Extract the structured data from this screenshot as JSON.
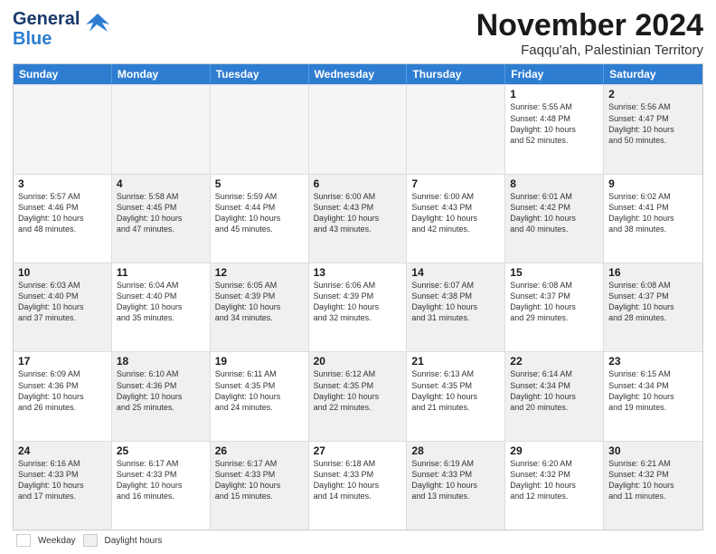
{
  "header": {
    "logo_line1": "General",
    "logo_line2": "Blue",
    "title": "November 2024",
    "subtitle": "Faqqu'ah, Palestinian Territory"
  },
  "calendar": {
    "days_of_week": [
      "Sunday",
      "Monday",
      "Tuesday",
      "Wednesday",
      "Thursday",
      "Friday",
      "Saturday"
    ],
    "weeks": [
      [
        {
          "day": "",
          "info": "",
          "empty": true
        },
        {
          "day": "",
          "info": "",
          "empty": true
        },
        {
          "day": "",
          "info": "",
          "empty": true
        },
        {
          "day": "",
          "info": "",
          "empty": true
        },
        {
          "day": "",
          "info": "",
          "empty": true
        },
        {
          "day": "1",
          "info": "Sunrise: 5:55 AM\nSunset: 4:48 PM\nDaylight: 10 hours\nand 52 minutes.",
          "shaded": false
        },
        {
          "day": "2",
          "info": "Sunrise: 5:56 AM\nSunset: 4:47 PM\nDaylight: 10 hours\nand 50 minutes.",
          "shaded": true
        }
      ],
      [
        {
          "day": "3",
          "info": "Sunrise: 5:57 AM\nSunset: 4:46 PM\nDaylight: 10 hours\nand 48 minutes.",
          "shaded": false
        },
        {
          "day": "4",
          "info": "Sunrise: 5:58 AM\nSunset: 4:45 PM\nDaylight: 10 hours\nand 47 minutes.",
          "shaded": true
        },
        {
          "day": "5",
          "info": "Sunrise: 5:59 AM\nSunset: 4:44 PM\nDaylight: 10 hours\nand 45 minutes.",
          "shaded": false
        },
        {
          "day": "6",
          "info": "Sunrise: 6:00 AM\nSunset: 4:43 PM\nDaylight: 10 hours\nand 43 minutes.",
          "shaded": true
        },
        {
          "day": "7",
          "info": "Sunrise: 6:00 AM\nSunset: 4:43 PM\nDaylight: 10 hours\nand 42 minutes.",
          "shaded": false
        },
        {
          "day": "8",
          "info": "Sunrise: 6:01 AM\nSunset: 4:42 PM\nDaylight: 10 hours\nand 40 minutes.",
          "shaded": true
        },
        {
          "day": "9",
          "info": "Sunrise: 6:02 AM\nSunset: 4:41 PM\nDaylight: 10 hours\nand 38 minutes.",
          "shaded": false
        }
      ],
      [
        {
          "day": "10",
          "info": "Sunrise: 6:03 AM\nSunset: 4:40 PM\nDaylight: 10 hours\nand 37 minutes.",
          "shaded": true
        },
        {
          "day": "11",
          "info": "Sunrise: 6:04 AM\nSunset: 4:40 PM\nDaylight: 10 hours\nand 35 minutes.",
          "shaded": false
        },
        {
          "day": "12",
          "info": "Sunrise: 6:05 AM\nSunset: 4:39 PM\nDaylight: 10 hours\nand 34 minutes.",
          "shaded": true
        },
        {
          "day": "13",
          "info": "Sunrise: 6:06 AM\nSunset: 4:39 PM\nDaylight: 10 hours\nand 32 minutes.",
          "shaded": false
        },
        {
          "day": "14",
          "info": "Sunrise: 6:07 AM\nSunset: 4:38 PM\nDaylight: 10 hours\nand 31 minutes.",
          "shaded": true
        },
        {
          "day": "15",
          "info": "Sunrise: 6:08 AM\nSunset: 4:37 PM\nDaylight: 10 hours\nand 29 minutes.",
          "shaded": false
        },
        {
          "day": "16",
          "info": "Sunrise: 6:08 AM\nSunset: 4:37 PM\nDaylight: 10 hours\nand 28 minutes.",
          "shaded": true
        }
      ],
      [
        {
          "day": "17",
          "info": "Sunrise: 6:09 AM\nSunset: 4:36 PM\nDaylight: 10 hours\nand 26 minutes.",
          "shaded": false
        },
        {
          "day": "18",
          "info": "Sunrise: 6:10 AM\nSunset: 4:36 PM\nDaylight: 10 hours\nand 25 minutes.",
          "shaded": true
        },
        {
          "day": "19",
          "info": "Sunrise: 6:11 AM\nSunset: 4:35 PM\nDaylight: 10 hours\nand 24 minutes.",
          "shaded": false
        },
        {
          "day": "20",
          "info": "Sunrise: 6:12 AM\nSunset: 4:35 PM\nDaylight: 10 hours\nand 22 minutes.",
          "shaded": true
        },
        {
          "day": "21",
          "info": "Sunrise: 6:13 AM\nSunset: 4:35 PM\nDaylight: 10 hours\nand 21 minutes.",
          "shaded": false
        },
        {
          "day": "22",
          "info": "Sunrise: 6:14 AM\nSunset: 4:34 PM\nDaylight: 10 hours\nand 20 minutes.",
          "shaded": true
        },
        {
          "day": "23",
          "info": "Sunrise: 6:15 AM\nSunset: 4:34 PM\nDaylight: 10 hours\nand 19 minutes.",
          "shaded": false
        }
      ],
      [
        {
          "day": "24",
          "info": "Sunrise: 6:16 AM\nSunset: 4:33 PM\nDaylight: 10 hours\nand 17 minutes.",
          "shaded": true
        },
        {
          "day": "25",
          "info": "Sunrise: 6:17 AM\nSunset: 4:33 PM\nDaylight: 10 hours\nand 16 minutes.",
          "shaded": false
        },
        {
          "day": "26",
          "info": "Sunrise: 6:17 AM\nSunset: 4:33 PM\nDaylight: 10 hours\nand 15 minutes.",
          "shaded": true
        },
        {
          "day": "27",
          "info": "Sunrise: 6:18 AM\nSunset: 4:33 PM\nDaylight: 10 hours\nand 14 minutes.",
          "shaded": false
        },
        {
          "day": "28",
          "info": "Sunrise: 6:19 AM\nSunset: 4:33 PM\nDaylight: 10 hours\nand 13 minutes.",
          "shaded": true
        },
        {
          "day": "29",
          "info": "Sunrise: 6:20 AM\nSunset: 4:32 PM\nDaylight: 10 hours\nand 12 minutes.",
          "shaded": false
        },
        {
          "day": "30",
          "info": "Sunrise: 6:21 AM\nSunset: 4:32 PM\nDaylight: 10 hours\nand 11 minutes.",
          "shaded": true
        }
      ]
    ]
  },
  "legend": {
    "light_label": "Weekday",
    "dark_label": "Daylight hours"
  }
}
